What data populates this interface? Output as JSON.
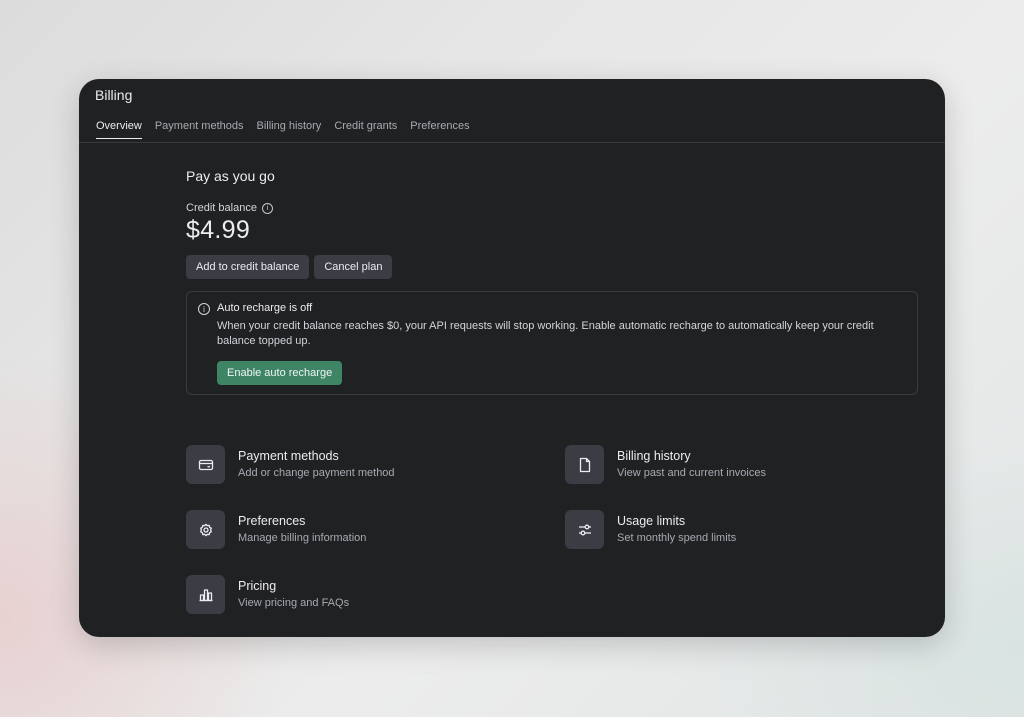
{
  "window": {
    "title": "Billing"
  },
  "tabs": [
    {
      "label": "Overview",
      "active": true
    },
    {
      "label": "Payment methods",
      "active": false
    },
    {
      "label": "Billing history",
      "active": false
    },
    {
      "label": "Credit grants",
      "active": false
    },
    {
      "label": "Preferences",
      "active": false
    }
  ],
  "plan": {
    "title": "Pay as you go",
    "credit_label": "Credit balance",
    "balance": "$4.99",
    "add_button": "Add to credit balance",
    "cancel_button": "Cancel plan"
  },
  "alert": {
    "title": "Auto recharge is off",
    "body": "When your credit balance reaches $0, your API requests will stop working. Enable automatic recharge to automatically keep your credit balance topped up.",
    "button": "Enable auto recharge"
  },
  "cards": [
    {
      "title": "Payment methods",
      "subtitle": "Add or change payment method",
      "icon": "credit-card-icon"
    },
    {
      "title": "Billing history",
      "subtitle": "View past and current invoices",
      "icon": "document-icon"
    },
    {
      "title": "Preferences",
      "subtitle": "Manage billing information",
      "icon": "gear-icon"
    },
    {
      "title": "Usage limits",
      "subtitle": "Set monthly spend limits",
      "icon": "sliders-icon"
    },
    {
      "title": "Pricing",
      "subtitle": "View pricing and FAQs",
      "icon": "bar-chart-icon"
    }
  ],
  "colors": {
    "window_bg": "#202123",
    "button_bg": "#3b3c44",
    "accent_green": "#3e8566"
  }
}
